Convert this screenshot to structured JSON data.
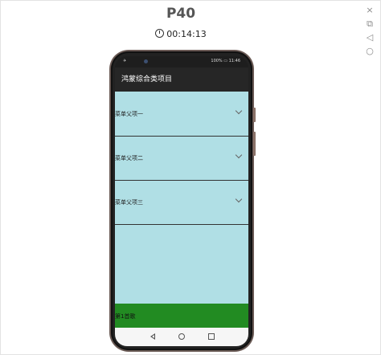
{
  "window": {
    "device_name": "P40",
    "timer": "00:14:13",
    "tools": {
      "close_icon": "×",
      "screenshot_icon": "⧉",
      "back_icon": "◁",
      "home_icon": "○"
    }
  },
  "phone": {
    "status_bar": {
      "left": "✈",
      "right": "100% ▭ 11:46"
    },
    "app_bar": {
      "title": "鸿蒙综合类项目"
    },
    "menu": {
      "items": [
        {
          "label": "菜单父项一"
        },
        {
          "label": "菜单父项二"
        },
        {
          "label": "菜单父项三"
        }
      ]
    },
    "footer": {
      "text": "第1首歌"
    }
  },
  "colors": {
    "content_bg": "#b0dfe5",
    "footer_bg": "#228b22",
    "app_bar_bg": "#262626"
  }
}
